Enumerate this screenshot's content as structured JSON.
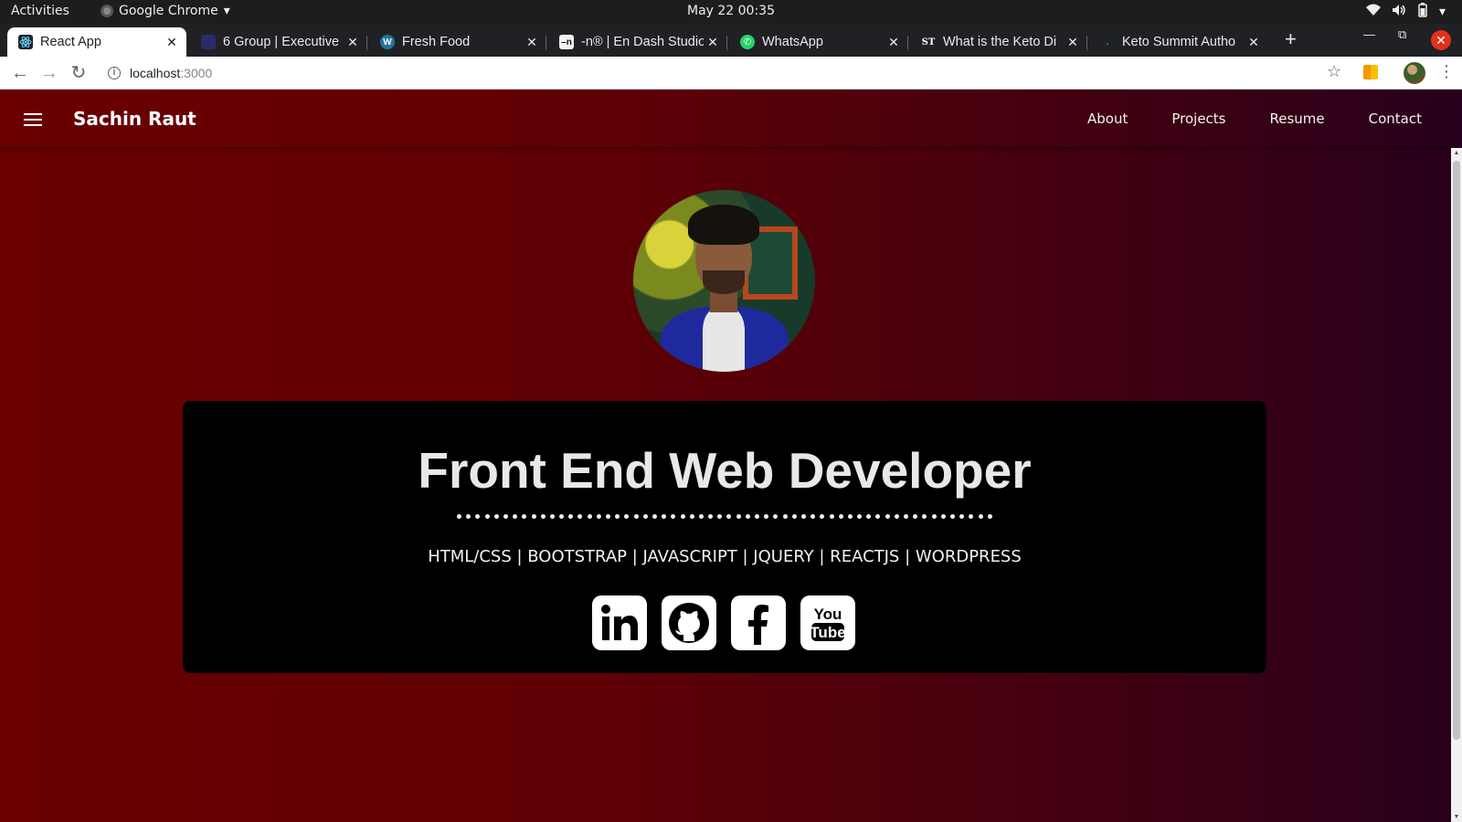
{
  "system_bar": {
    "activities": "Activities",
    "app_name": "Google Chrome",
    "clock": "May 22  00:35"
  },
  "browser": {
    "tabs": [
      {
        "title": "React App",
        "active": true,
        "favicon_color": "#61dafb"
      },
      {
        "title": "6 Group | Executive",
        "active": false,
        "favicon_color": "#2b2b6a"
      },
      {
        "title": "Fresh Food",
        "active": false,
        "favicon_color": "#21759b"
      },
      {
        "title": "-n® | En Dash Studio",
        "active": false,
        "favicon_color": "#111111"
      },
      {
        "title": "WhatsApp",
        "active": false,
        "favicon_color": "#25d366"
      },
      {
        "title": "What is the Keto Di",
        "active": false,
        "favicon_color": "#202124"
      },
      {
        "title": "Keto Summit Autho",
        "active": false,
        "favicon_color": "#1aa3c9"
      }
    ],
    "url_host": "localhost",
    "url_port": ":3000"
  },
  "site": {
    "brand": "Sachin Raut",
    "nav": [
      {
        "label": "About"
      },
      {
        "label": "Projects"
      },
      {
        "label": "Resume"
      },
      {
        "label": "Contact"
      }
    ],
    "headline": "Front End Web Developer",
    "skills": "HTML/CSS | BOOTSTRAP | JAVASCRIPT | JQUERY | REACTJS | WORDPRESS",
    "social": [
      {
        "icon": "linkedin-icon"
      },
      {
        "icon": "github-icon"
      },
      {
        "icon": "facebook-icon"
      },
      {
        "icon": "youtube-icon"
      }
    ]
  },
  "colors": {
    "background_left": "#6a0000",
    "background_right": "#28001d",
    "card": "#000000",
    "text": "#f2f2f2"
  }
}
